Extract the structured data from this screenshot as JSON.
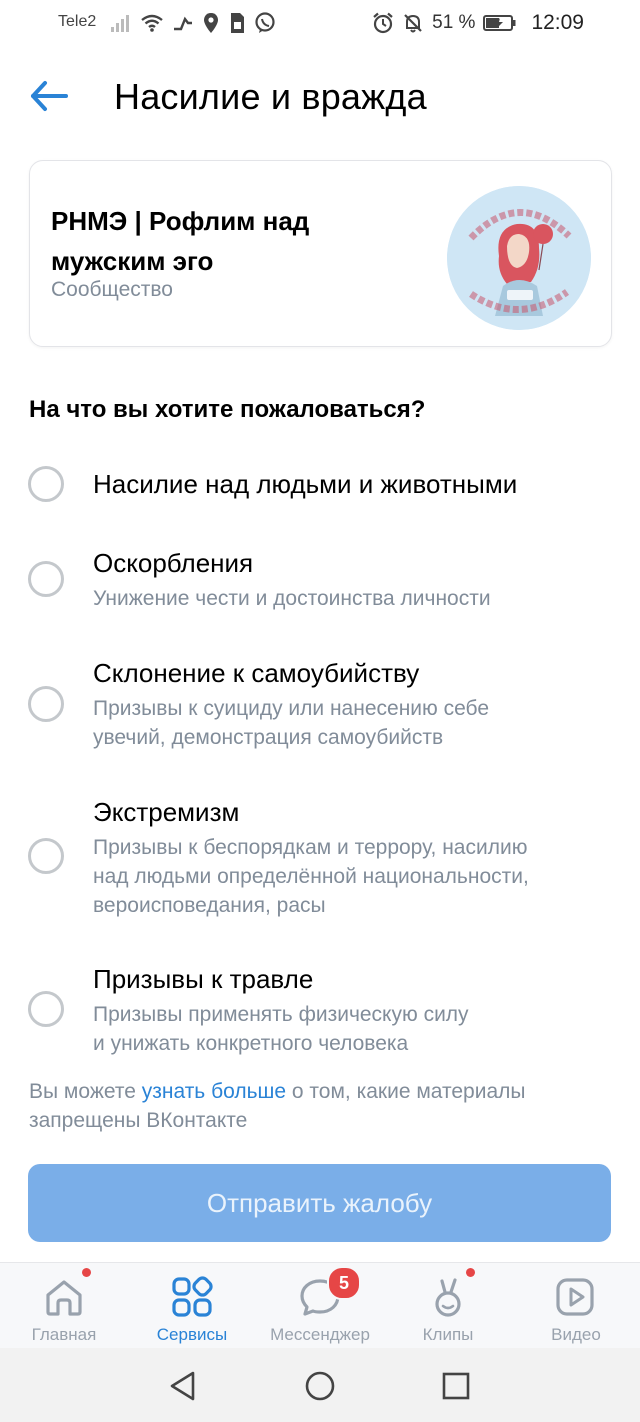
{
  "status_bar": {
    "carrier": "Tele2",
    "battery_percent": "51 %",
    "time": "12:09"
  },
  "header": {
    "title": "Насилие и вражда"
  },
  "community": {
    "name": "РНМЭ | Рофлим над мужским эго",
    "type": "Сообщество"
  },
  "question": "На что вы хотите пожаловаться?",
  "options": [
    {
      "title": "Насилие над людьми и животными",
      "description": ""
    },
    {
      "title": "Оскорбления",
      "description": "Унижение чести и достоинства личности"
    },
    {
      "title": "Склонение к самоубийству",
      "description": "Призывы к суициду или нанесению себе\nувечий, демонстрация самоубийств"
    },
    {
      "title": "Экстремизм",
      "description": "Призывы к беспорядкам и террору, насилию\nнад людьми определённой национальности,\nвероисповедания, расы"
    },
    {
      "title": "Призывы к травле",
      "description": "Призывы применять физическую силу\nи унижать конкретного человека"
    }
  ],
  "info": {
    "prefix": "Вы можете ",
    "link": "узнать больше",
    "suffix": " о том, какие материалы запрещены ВКонтакте"
  },
  "submit_label": "Отправить жалобу",
  "tabs": [
    {
      "label": "Главная",
      "icon": "home-icon"
    },
    {
      "label": "Сервисы",
      "icon": "services-icon"
    },
    {
      "label": "Мессенджер",
      "icon": "messenger-icon",
      "badge": "5"
    },
    {
      "label": "Клипы",
      "icon": "clips-icon"
    },
    {
      "label": "Видео",
      "icon": "video-icon"
    }
  ],
  "colors": {
    "accent": "#2a83d6",
    "button_disabled": "#7aaee8",
    "secondary_text": "#818c99",
    "badge": "#e64646"
  }
}
